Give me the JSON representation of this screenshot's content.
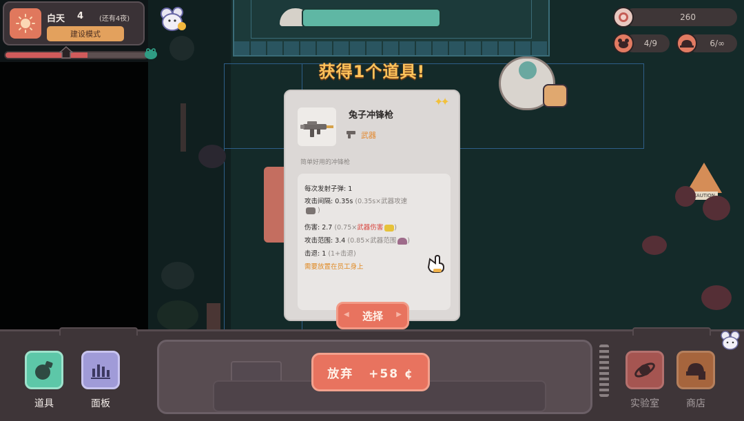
{
  "hud": {
    "day_label": "白天",
    "day_number": "4",
    "days_left": "(还有4夜)",
    "build_mode_label": "建设模式",
    "day_progress": 0.58,
    "coins": "260",
    "pets": "4/9",
    "workers": "6/∞"
  },
  "headline": "获得1个道具!",
  "item": {
    "name": "兔子冲锋枪",
    "category": "武器",
    "description": "简单好用的冲锋枪",
    "stats": {
      "bullets_label": "每次发射子弹",
      "bullets_value": ": 1",
      "interval_label": "攻击间隔",
      "interval_value": ": 0.35s",
      "interval_formula": "(0.35s×武器攻速",
      "interval_close": ")",
      "damage_label": "伤害",
      "damage_value": ": 2.7",
      "damage_formula_pre": "(0.75×",
      "damage_formula_red": "武器伤害",
      "damage_close": ")",
      "range_label": "攻击范围",
      "range_value": ": 3.4",
      "range_formula": "(0.85×武器范围",
      "range_close": ")",
      "knockback_label": "击退",
      "knockback_value": ": 1",
      "knockback_formula": "(1+击退)",
      "requirement": "需要放置在员工身上"
    },
    "select_label": "选择"
  },
  "bottom": {
    "items_label": "道具",
    "panel_label": "面板",
    "discard_label": "放弃",
    "discard_reward": "+58 ¢",
    "lab_label": "实验室",
    "shop_label": "商店"
  },
  "colors": {
    "accent": "#e8735f",
    "headline": "#ffc25a",
    "category": "#e3872c",
    "damage_red": "#d8443c"
  }
}
